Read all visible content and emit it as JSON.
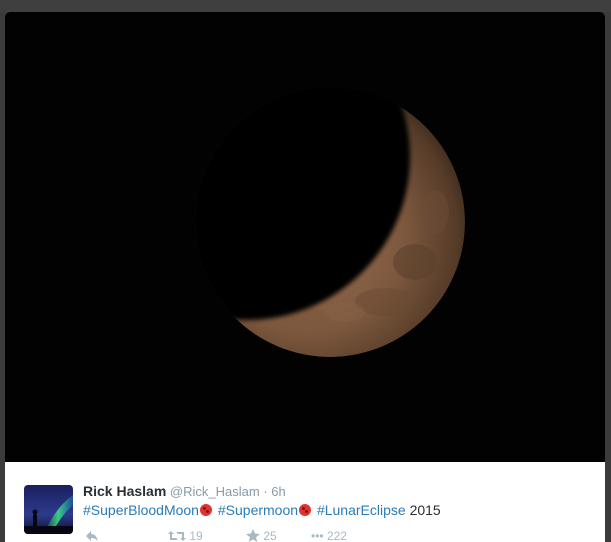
{
  "tweet": {
    "author_name": "Rick Haslam",
    "handle": "@Rick_Haslam",
    "separator": "·",
    "time": "6h",
    "hashtags": [
      "#SuperBloodMoon",
      "#Supermoon",
      "#LunarEclipse"
    ],
    "year": "2015"
  },
  "actions": {
    "retweet_count": "19",
    "favorite_count": "25",
    "more_count": "222"
  },
  "colors": {
    "hashtag": "#2b7bb9",
    "name": "#292f33",
    "meta": "#8899a6",
    "photo_bg": "#020202"
  },
  "icons": [
    "reply-icon",
    "retweet-icon",
    "favorite-icon",
    "more-icon",
    "blood-moon-emoji-icon"
  ]
}
